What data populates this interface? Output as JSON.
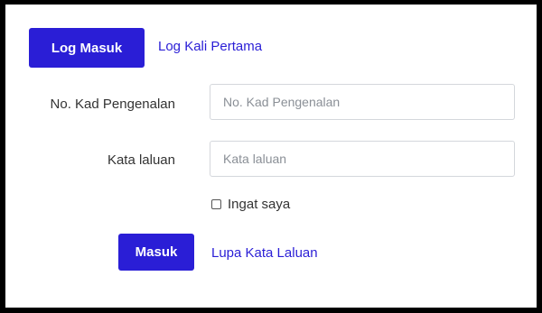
{
  "tabs": {
    "active_label": "Log Masuk",
    "first_time_label": "Log Kali Pertama"
  },
  "form": {
    "ic_label": "No. Kad Pengenalan",
    "ic_placeholder": "No. Kad Pengenalan",
    "password_label": "Kata laluan",
    "password_placeholder": "Kata laluan",
    "remember_label": "Ingat saya",
    "submit_label": "Masuk",
    "forgot_label": "Lupa Kata Laluan"
  },
  "colors": {
    "accent": "#2a1ed6",
    "text": "#333333",
    "placeholder": "#8a8f96",
    "input_border": "#d4d7dc",
    "frame": "#000000",
    "card": "#ffffff"
  }
}
